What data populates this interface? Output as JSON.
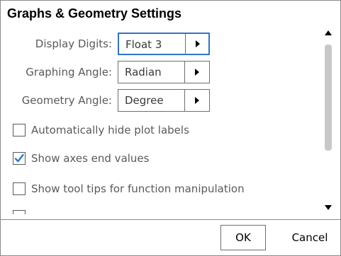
{
  "dialog": {
    "title": "Graphs & Geometry Settings",
    "settings": [
      {
        "label": "Display Digits:",
        "value": "Float 3",
        "focused": true
      },
      {
        "label": "Graphing Angle:",
        "value": "Radian",
        "focused": false
      },
      {
        "label": "Geometry Angle:",
        "value": "Degree",
        "focused": false
      }
    ],
    "options": [
      {
        "label": "Automatically hide plot labels",
        "checked": false
      },
      {
        "label": "Show axes end values",
        "checked": true
      },
      {
        "label": "Show tool tips for function manipulation",
        "checked": false
      }
    ],
    "buttons": {
      "ok": "OK",
      "cancel": "Cancel"
    },
    "colors": {
      "focus": "#2f75c8",
      "check": "#2f75c8",
      "scroll_thumb": "#c8c8c8"
    },
    "icons": {
      "dropdown": "triangle-right-icon",
      "scroll_up": "scroll-up-arrow-icon",
      "scroll_down": "scroll-down-arrow-icon",
      "check": "checkmark-icon"
    }
  }
}
